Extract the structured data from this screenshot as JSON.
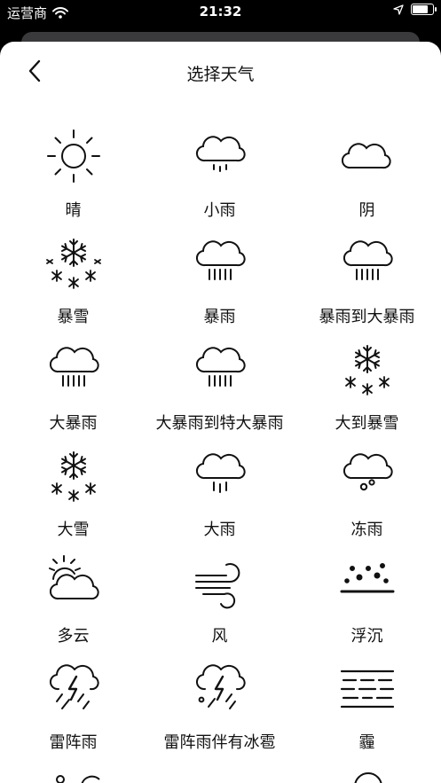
{
  "status_bar": {
    "carrier": "运营商",
    "time": "21:32"
  },
  "header": {
    "title": "选择天气"
  },
  "weather_items": [
    {
      "label": "晴",
      "icon": "sun-icon"
    },
    {
      "label": "小雨",
      "icon": "light-rain-icon"
    },
    {
      "label": "阴",
      "icon": "cloud-icon"
    },
    {
      "label": "暴雪",
      "icon": "snowflake-icon"
    },
    {
      "label": "暴雨",
      "icon": "heavy-rain-icon"
    },
    {
      "label": "暴雨到大暴雨",
      "icon": "heavy-rain-icon"
    },
    {
      "label": "大暴雨",
      "icon": "heavy-rain-icon"
    },
    {
      "label": "大暴雨到特大暴雨",
      "icon": "heavy-rain-icon"
    },
    {
      "label": "大到暴雪",
      "icon": "snowflake-icon"
    },
    {
      "label": "大雪",
      "icon": "snowflake-icon"
    },
    {
      "label": "大雨",
      "icon": "rain-icon"
    },
    {
      "label": "冻雨",
      "icon": "freezing-rain-icon"
    },
    {
      "label": "多云",
      "icon": "partly-cloudy-icon"
    },
    {
      "label": "风",
      "icon": "wind-icon"
    },
    {
      "label": "浮沉",
      "icon": "dust-icon"
    },
    {
      "label": "雷阵雨",
      "icon": "thunderstorm-icon"
    },
    {
      "label": "雷阵雨伴有冰雹",
      "icon": "thunder-hail-icon"
    },
    {
      "label": "霾",
      "icon": "haze-icon"
    }
  ]
}
